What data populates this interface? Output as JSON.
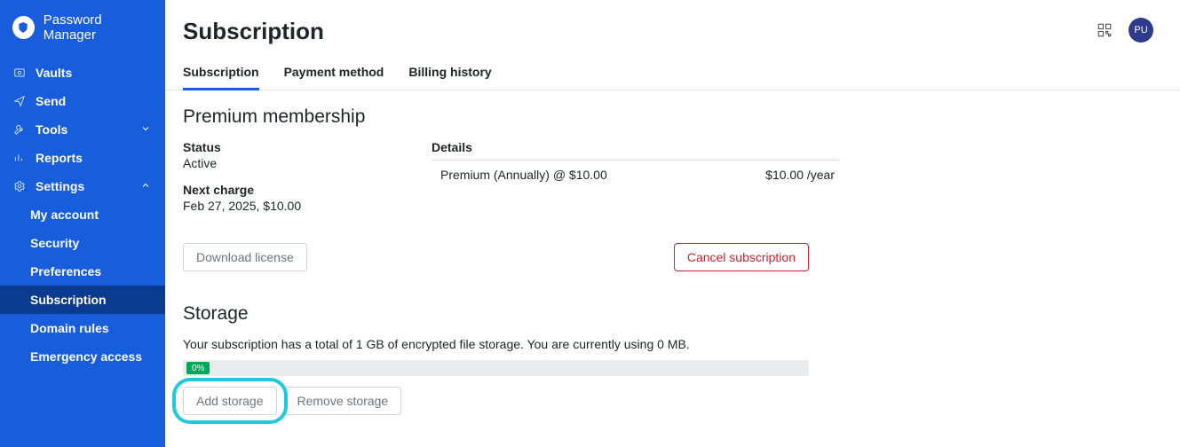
{
  "brand": {
    "name": "Password Manager"
  },
  "sidebar": {
    "items": [
      {
        "label": "Vaults"
      },
      {
        "label": "Send"
      },
      {
        "label": "Tools"
      },
      {
        "label": "Reports"
      },
      {
        "label": "Settings"
      }
    ],
    "settings_children": [
      {
        "label": "My account"
      },
      {
        "label": "Security"
      },
      {
        "label": "Preferences"
      },
      {
        "label": "Subscription"
      },
      {
        "label": "Domain rules"
      },
      {
        "label": "Emergency access"
      }
    ]
  },
  "header": {
    "title": "Subscription",
    "avatar_initials": "PU"
  },
  "tabs": [
    {
      "label": "Subscription"
    },
    {
      "label": "Payment method"
    },
    {
      "label": "Billing history"
    }
  ],
  "premium": {
    "heading": "Premium membership",
    "status_label": "Status",
    "status_value": "Active",
    "next_charge_label": "Next charge",
    "next_charge_value": "Feb 27, 2025, $10.00",
    "details_label": "Details",
    "details_item": "Premium (Annually) @ $10.00",
    "details_price": "$10.00 /year",
    "download_license": "Download license",
    "cancel_subscription": "Cancel subscription"
  },
  "storage": {
    "heading": "Storage",
    "desc": "Your subscription has a total of 1 GB of encrypted file storage. You are currently using 0 MB.",
    "percent": "0%",
    "add": "Add storage",
    "remove": "Remove storage"
  }
}
